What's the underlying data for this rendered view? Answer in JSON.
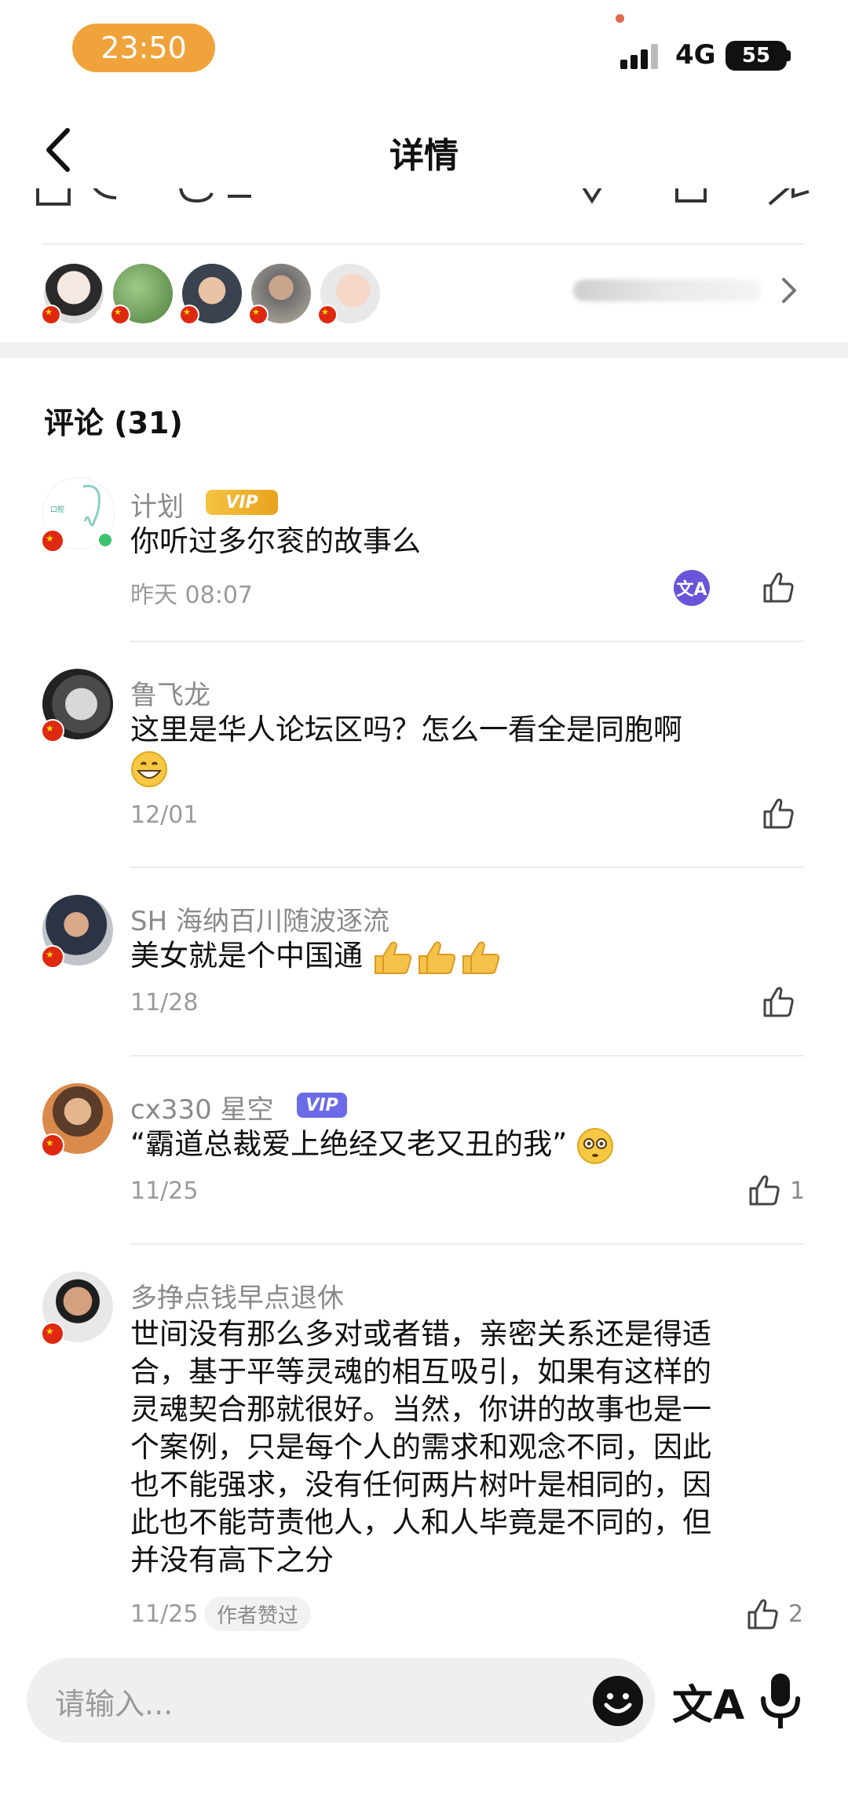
{
  "status": {
    "time": "23:50",
    "network": "4G",
    "battery": "55"
  },
  "nav": {
    "title": "详情"
  },
  "comments": {
    "header": "评论 (31)",
    "items": [
      {
        "name": "计划",
        "badge": "VIP",
        "text": "你听过多尔衮的故事么",
        "date": "昨天 08:07",
        "likes": ""
      },
      {
        "name": "鲁飞龙",
        "text": "这里是华人论坛区吗？怎么一看全是同胞啊",
        "date": "12/01",
        "likes": ""
      },
      {
        "name": "SH 海纳百川随波逐流",
        "text": "美女就是个中国通",
        "date": "11/28",
        "likes": ""
      },
      {
        "name": "cx330 星空",
        "badge": "VIP",
        "text": "“霸道总裁爱上绝经又老又丑的我”",
        "date": "11/25",
        "likes": "1"
      },
      {
        "name": "多挣点钱早点退休",
        "text_lines": [
          "世间没有那么多对或者错，亲密关系还是得适",
          "合，基于平等灵魂的相互吸引，如果有这样的",
          "灵魂契合那就很好。当然，你讲的故事也是一",
          "个案例，只是每个人的需求和观念不同，因此",
          "也不能强求，没有任何两片树叶是相同的，因",
          "此也不能苛责他人，人和人毕竟是不同的，但",
          "并没有高下之分"
        ],
        "date": "11/25",
        "tag": "作者赞过",
        "likes": "2"
      }
    ]
  },
  "input": {
    "placeholder": "请输入..."
  },
  "icons": {
    "back": "chevron-left-icon",
    "like": "thumbs-up-icon",
    "translate": "translate-icon",
    "emoji": "emoji-icon",
    "mic": "microphone-icon",
    "arrow": "chevron-right-icon"
  },
  "colors": {
    "time_pill": "#f0a33a",
    "vip_gold": "#e9a21d",
    "vip_blue": "#6b6be8",
    "translate_badge": "#6a55d8",
    "online": "#3cc46d"
  }
}
